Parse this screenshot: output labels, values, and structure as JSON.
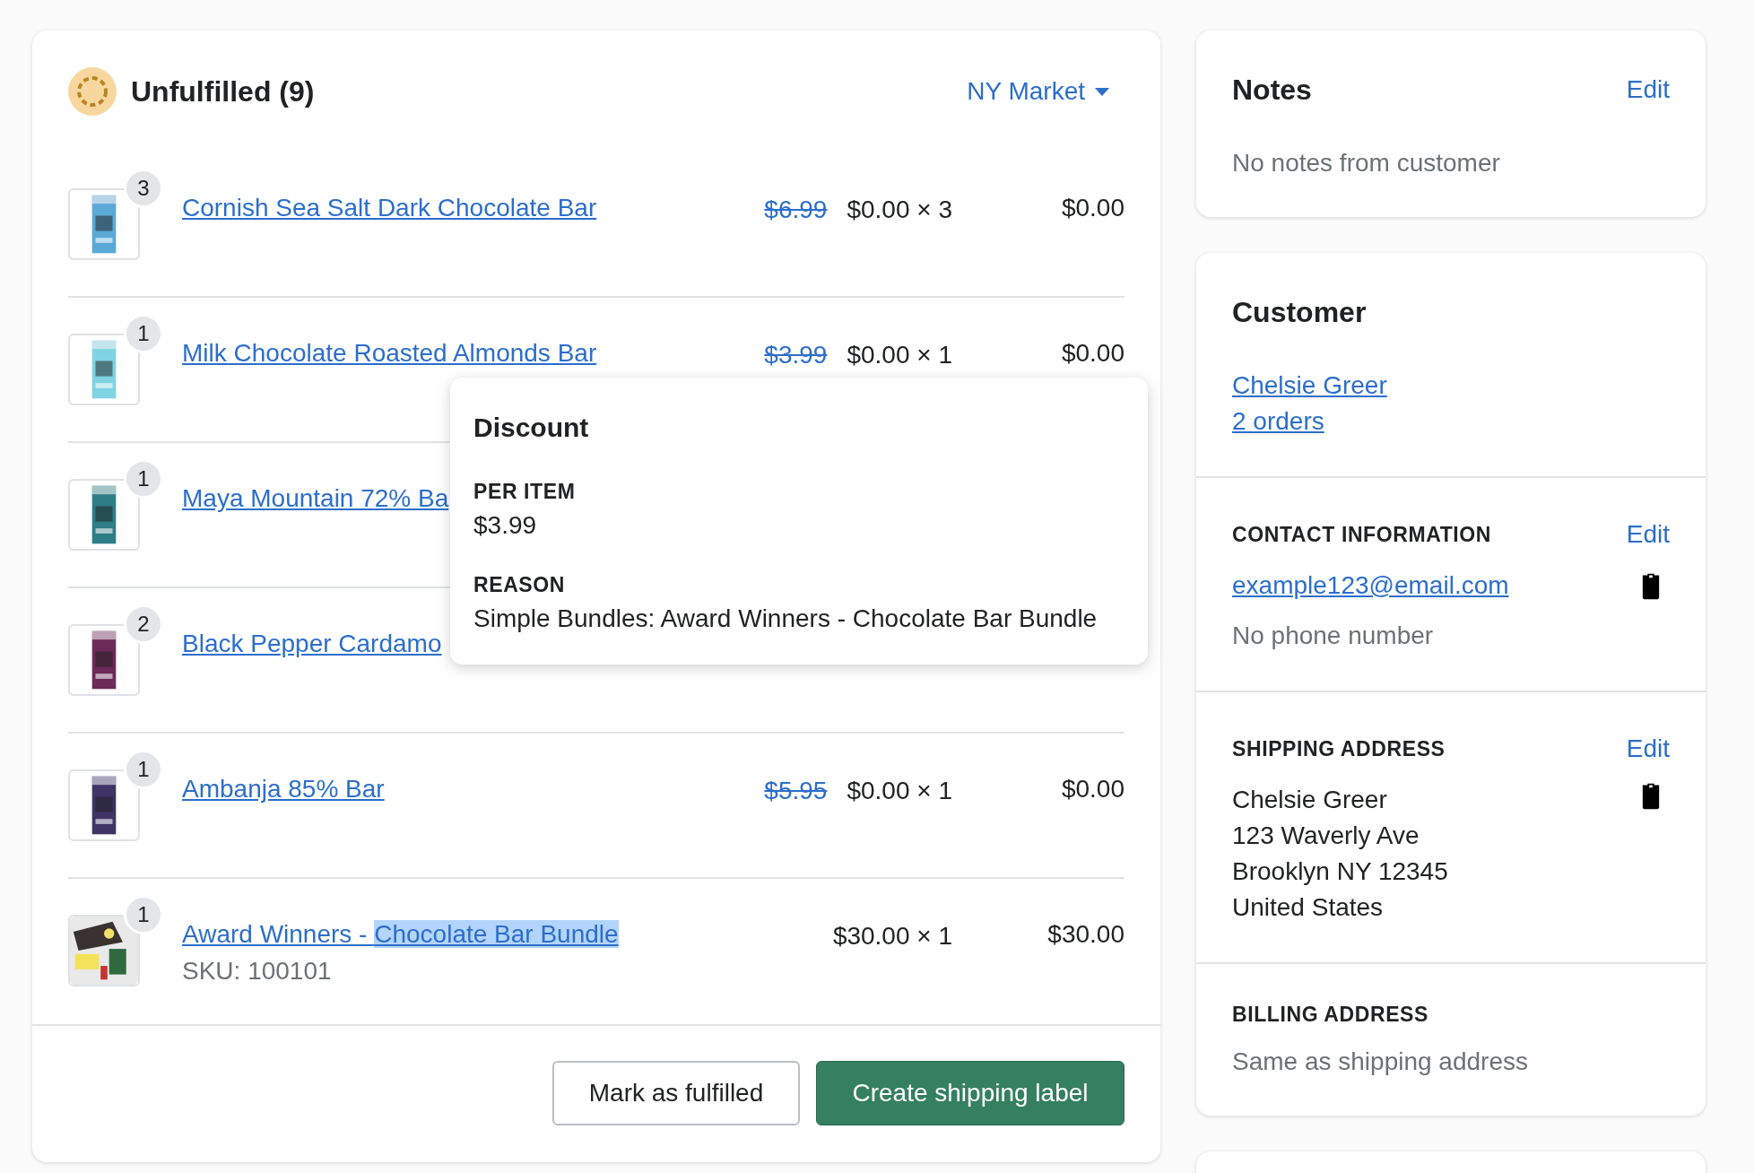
{
  "fulfillment": {
    "title": "Unfulfilled (9)",
    "location": "NY Market",
    "items": [
      {
        "quantity": "3",
        "name": "Cornish Sea Salt Dark Chocolate Bar",
        "original_price": "$6.99",
        "price": "$0.00 × 3",
        "total": "$0.00"
      },
      {
        "quantity": "1",
        "name": "Milk Chocolate Roasted Almonds Bar",
        "original_price": "$3.99",
        "price": "$0.00 × 1",
        "total": "$0.00"
      },
      {
        "quantity": "1",
        "name": "Maya Mountain 72% Ba"
      },
      {
        "quantity": "2",
        "name": "Black Pepper Cardamo"
      },
      {
        "quantity": "1",
        "name": "Ambanja 85% Bar",
        "original_price": "$5.95",
        "price": "$0.00 × 1",
        "total": "$0.00"
      },
      {
        "quantity": "1",
        "name": "Award Winners - ",
        "selected_text": "Chocolate Bar Bundle",
        "sku": "SKU: 100101",
        "price": "$30.00 × 1",
        "total": "$30.00"
      }
    ],
    "actions": [
      {
        "label": "Mark as fulfilled",
        "kind": "secondary"
      },
      {
        "label": "Create shipping label",
        "kind": "primary"
      }
    ]
  },
  "discount_popover": {
    "title": "Discount",
    "fields": [
      {
        "label": "PER ITEM",
        "value": "$3.99"
      },
      {
        "label": "REASON",
        "value": "Simple Bundles: Award Winners - Chocolate Bar Bundle"
      }
    ]
  },
  "notes": {
    "title": "Notes",
    "action": "Edit",
    "text": "No notes from customer"
  },
  "customer": {
    "title": "Customer",
    "name": "Chelsie Greer",
    "orders": "2 orders",
    "contact": {
      "heading": "CONTACT INFORMATION",
      "action": "Edit",
      "email": "example123@email.com",
      "phone": "No phone number"
    },
    "shipping": {
      "heading": "SHIPPING ADDRESS",
      "action": "Edit",
      "lines": [
        "Chelsie Greer",
        "123 Waverly Ave",
        "Brooklyn NY 12345",
        "United States"
      ]
    },
    "billing": {
      "heading": "BILLING ADDRESS",
      "text": "Same as shipping address"
    }
  }
}
